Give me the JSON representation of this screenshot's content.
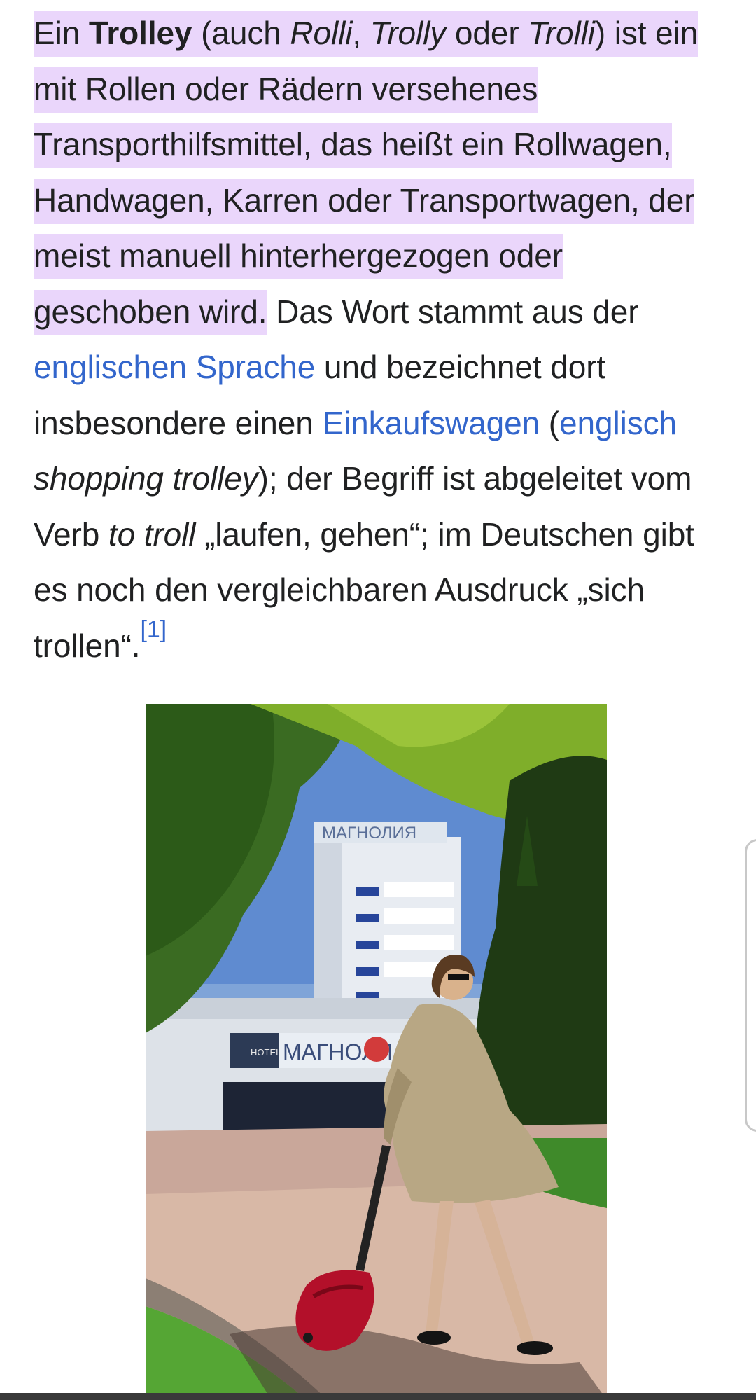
{
  "article": {
    "p1": {
      "s1": "Ein ",
      "term": "Trolley",
      "s2": " (auch ",
      "alt1": "Rolli",
      "s3": ", ",
      "alt2": "Trolly",
      "s4": " oder ",
      "alt3": "Trolli",
      "s5": ") ist ein mit Rollen oder Rädern versehenes Transporthilfsmittel, das heißt ein Rollwagen, Handwagen, Karren oder Transportwagen, der meist manuell hinterhergezogen oder geschoben wird.",
      "s6": " Das Wort stammt aus der ",
      "link_sprache": "englischen Sprache",
      "s7": " und bezeichnet dort insbesondere einen ",
      "link_einkauf": "Einkaufswagen",
      "s8": " (",
      "link_englisch": "englisch",
      "s9_italic": " shopping trolley",
      "s10": "); der Begriff ist abgeleitet vom Verb ",
      "verb": "to troll",
      "s11": " „laufen, gehen“; im Deutschen gibt es noch den vergleichbaren Ausdruck „sich trollen“.",
      "ref": "[1]"
    }
  },
  "figure": {
    "hotel_sign_top": "МАГНОЛИЯ",
    "hotel_sign_entrance": "МАГНОЛИ",
    "hotel_small": "HOTEL"
  },
  "colors": {
    "highlight": "#ead6fb",
    "link": "#3366cc",
    "text": "#202122"
  },
  "icons": {
    "scroll_handle": "fast-scroll-handle"
  }
}
